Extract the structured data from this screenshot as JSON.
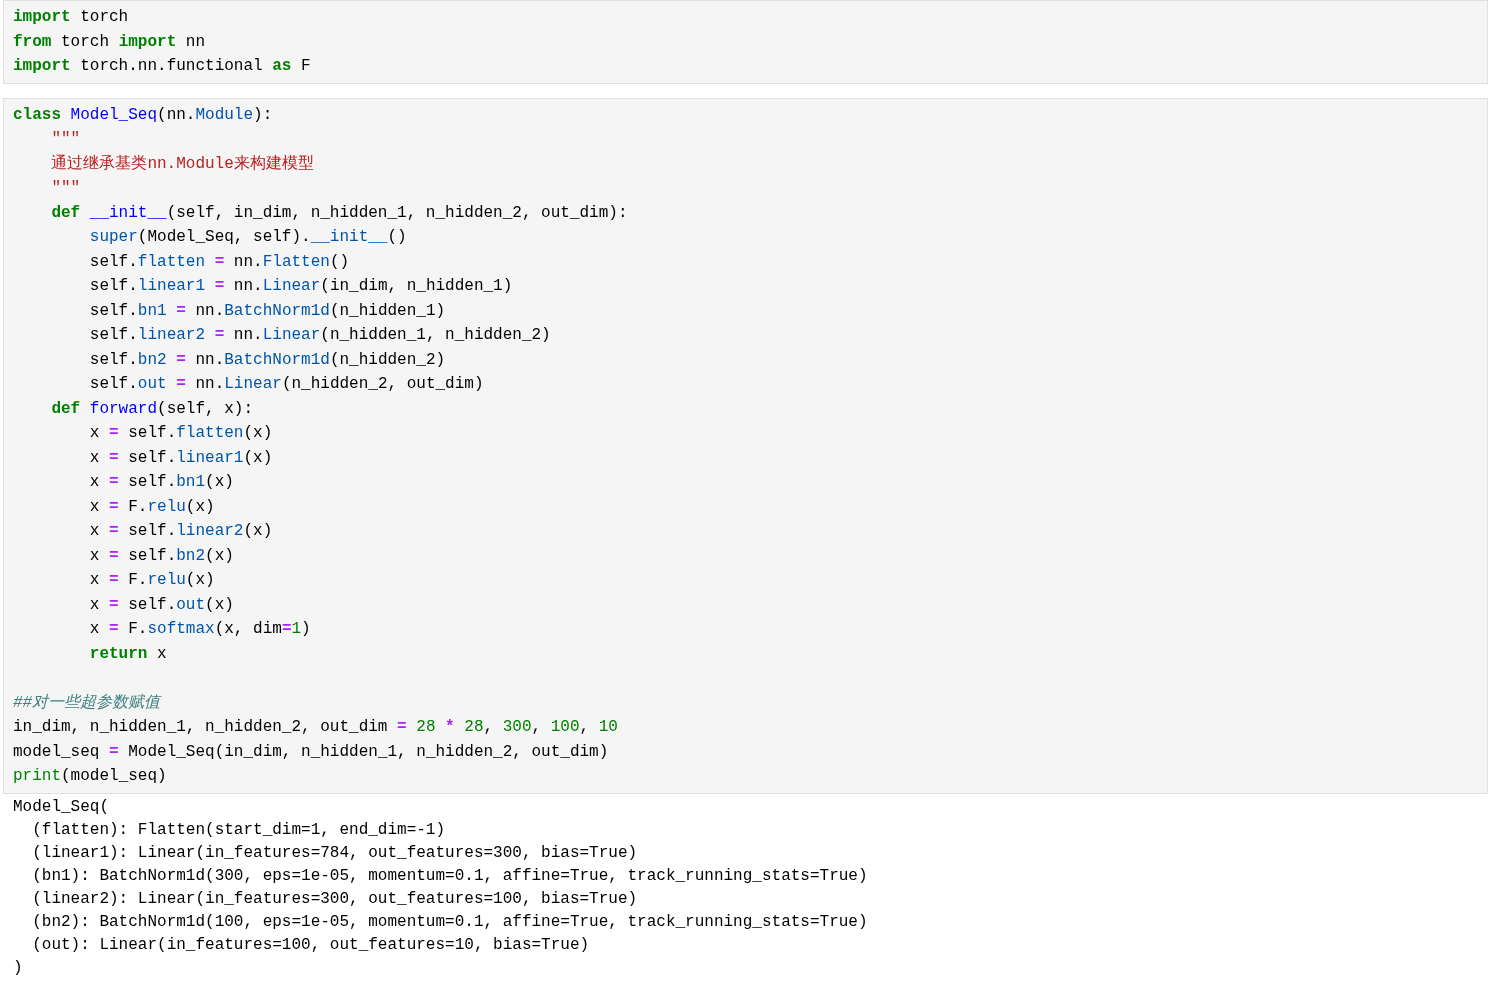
{
  "cells": [
    {
      "kind": "code",
      "blocks": [
        [
          [
            {
              "kind": "kw",
              "text": "import"
            },
            {
              "kind": "plain",
              "text": " torch"
            }
          ],
          [
            {
              "kind": "kw",
              "text": "from"
            },
            {
              "kind": "plain",
              "text": " torch "
            },
            {
              "kind": "kw",
              "text": "import"
            },
            {
              "kind": "plain",
              "text": " nn"
            }
          ],
          [
            {
              "kind": "kw",
              "text": "import"
            },
            {
              "kind": "plain",
              "text": " torch.nn.functional "
            },
            {
              "kind": "kw",
              "text": "as"
            },
            {
              "kind": "plain",
              "text": " F"
            }
          ]
        ]
      ]
    },
    {
      "kind": "code",
      "blocks": [
        [
          [
            {
              "kind": "kw",
              "text": "class "
            },
            {
              "kind": "def",
              "text": "Model_Seq"
            },
            {
              "kind": "plain",
              "text": "(nn."
            },
            {
              "kind": "attr",
              "text": "Module"
            },
            {
              "kind": "plain",
              "text": "):"
            }
          ],
          [
            {
              "kind": "str",
              "text": "    \"\"\""
            }
          ],
          [
            {
              "kind": "str",
              "text": "    通过继承基类nn.Module来构建模型"
            }
          ],
          [
            {
              "kind": "str",
              "text": "    \"\"\""
            }
          ],
          [
            {
              "kind": "kw",
              "text": "    def "
            },
            {
              "kind": "def",
              "text": "__init__"
            },
            {
              "kind": "plain",
              "text": "(self, in_dim, n_hidden_1, n_hidden_2, out_dim):"
            }
          ],
          [
            {
              "kind": "attr",
              "text": "        super"
            },
            {
              "kind": "plain",
              "text": "(Model_Seq, self)."
            },
            {
              "kind": "attr",
              "text": "__init__"
            },
            {
              "kind": "plain",
              "text": "()"
            }
          ],
          [
            {
              "kind": "plain",
              "text": "        self."
            },
            {
              "kind": "attr",
              "text": "flatten"
            },
            {
              "kind": "op",
              "text": " = "
            },
            {
              "kind": "plain",
              "text": "nn."
            },
            {
              "kind": "attr",
              "text": "Flatten"
            },
            {
              "kind": "plain",
              "text": "()"
            }
          ],
          [
            {
              "kind": "plain",
              "text": "        self."
            },
            {
              "kind": "attr",
              "text": "linear1"
            },
            {
              "kind": "op",
              "text": " = "
            },
            {
              "kind": "plain",
              "text": "nn."
            },
            {
              "kind": "attr",
              "text": "Linear"
            },
            {
              "kind": "plain",
              "text": "(in_dim, n_hidden_1)"
            }
          ],
          [
            {
              "kind": "plain",
              "text": "        self."
            },
            {
              "kind": "attr",
              "text": "bn1"
            },
            {
              "kind": "op",
              "text": " = "
            },
            {
              "kind": "plain",
              "text": "nn."
            },
            {
              "kind": "attr",
              "text": "BatchNorm1d"
            },
            {
              "kind": "plain",
              "text": "(n_hidden_1)"
            }
          ],
          [
            {
              "kind": "plain",
              "text": "        self."
            },
            {
              "kind": "attr",
              "text": "linear2"
            },
            {
              "kind": "op",
              "text": " = "
            },
            {
              "kind": "plain",
              "text": "nn."
            },
            {
              "kind": "attr",
              "text": "Linear"
            },
            {
              "kind": "plain",
              "text": "(n_hidden_1, n_hidden_2)"
            }
          ],
          [
            {
              "kind": "plain",
              "text": "        self."
            },
            {
              "kind": "attr",
              "text": "bn2"
            },
            {
              "kind": "op",
              "text": " = "
            },
            {
              "kind": "plain",
              "text": "nn."
            },
            {
              "kind": "attr",
              "text": "BatchNorm1d"
            },
            {
              "kind": "plain",
              "text": "(n_hidden_2)"
            }
          ],
          [
            {
              "kind": "plain",
              "text": "        self."
            },
            {
              "kind": "attr",
              "text": "out"
            },
            {
              "kind": "op",
              "text": " = "
            },
            {
              "kind": "plain",
              "text": "nn."
            },
            {
              "kind": "attr",
              "text": "Linear"
            },
            {
              "kind": "plain",
              "text": "(n_hidden_2, out_dim)"
            }
          ],
          [
            {
              "kind": "kw",
              "text": "    def "
            },
            {
              "kind": "def",
              "text": "forward"
            },
            {
              "kind": "plain",
              "text": "(self, x):"
            }
          ],
          [
            {
              "kind": "plain",
              "text": "        x"
            },
            {
              "kind": "op",
              "text": " = "
            },
            {
              "kind": "plain",
              "text": "self."
            },
            {
              "kind": "attr",
              "text": "flatten"
            },
            {
              "kind": "plain",
              "text": "(x)"
            }
          ],
          [
            {
              "kind": "plain",
              "text": "        x"
            },
            {
              "kind": "op",
              "text": " = "
            },
            {
              "kind": "plain",
              "text": "self."
            },
            {
              "kind": "attr",
              "text": "linear1"
            },
            {
              "kind": "plain",
              "text": "(x)"
            }
          ],
          [
            {
              "kind": "plain",
              "text": "        x"
            },
            {
              "kind": "op",
              "text": " = "
            },
            {
              "kind": "plain",
              "text": "self."
            },
            {
              "kind": "attr",
              "text": "bn1"
            },
            {
              "kind": "plain",
              "text": "(x)"
            }
          ],
          [
            {
              "kind": "plain",
              "text": "        x"
            },
            {
              "kind": "op",
              "text": " = "
            },
            {
              "kind": "plain",
              "text": "F."
            },
            {
              "kind": "attr",
              "text": "relu"
            },
            {
              "kind": "plain",
              "text": "(x)"
            }
          ],
          [
            {
              "kind": "plain",
              "text": "        x"
            },
            {
              "kind": "op",
              "text": " = "
            },
            {
              "kind": "plain",
              "text": "self."
            },
            {
              "kind": "attr",
              "text": "linear2"
            },
            {
              "kind": "plain",
              "text": "(x)"
            }
          ],
          [
            {
              "kind": "plain",
              "text": "        x"
            },
            {
              "kind": "op",
              "text": " = "
            },
            {
              "kind": "plain",
              "text": "self."
            },
            {
              "kind": "attr",
              "text": "bn2"
            },
            {
              "kind": "plain",
              "text": "(x)"
            }
          ],
          [
            {
              "kind": "plain",
              "text": "        x"
            },
            {
              "kind": "op",
              "text": " = "
            },
            {
              "kind": "plain",
              "text": "F."
            },
            {
              "kind": "attr",
              "text": "relu"
            },
            {
              "kind": "plain",
              "text": "(x)"
            }
          ],
          [
            {
              "kind": "plain",
              "text": "        x"
            },
            {
              "kind": "op",
              "text": " = "
            },
            {
              "kind": "plain",
              "text": "self."
            },
            {
              "kind": "attr",
              "text": "out"
            },
            {
              "kind": "plain",
              "text": "(x)"
            }
          ],
          [
            {
              "kind": "plain",
              "text": "        x"
            },
            {
              "kind": "op",
              "text": " = "
            },
            {
              "kind": "plain",
              "text": "F."
            },
            {
              "kind": "attr",
              "text": "softmax"
            },
            {
              "kind": "plain",
              "text": "(x, dim"
            },
            {
              "kind": "op",
              "text": "="
            },
            {
              "kind": "num",
              "text": "1"
            },
            {
              "kind": "plain",
              "text": ")"
            }
          ],
          [
            {
              "kind": "kw",
              "text": "        return"
            },
            {
              "kind": "plain",
              "text": " x"
            }
          ]
        ],
        [
          [
            {
              "kind": "com",
              "text": "##对一些超参数赋值"
            }
          ],
          [
            {
              "kind": "plain",
              "text": "in_dim, n_hidden_1, n_hidden_2, out_dim"
            },
            {
              "kind": "op",
              "text": " = "
            },
            {
              "kind": "num",
              "text": "28"
            },
            {
              "kind": "op",
              "text": " * "
            },
            {
              "kind": "num",
              "text": "28"
            },
            {
              "kind": "plain",
              "text": ", "
            },
            {
              "kind": "num",
              "text": "300"
            },
            {
              "kind": "plain",
              "text": ", "
            },
            {
              "kind": "num",
              "text": "100"
            },
            {
              "kind": "plain",
              "text": ", "
            },
            {
              "kind": "num",
              "text": "10"
            }
          ],
          [
            {
              "kind": "plain",
              "text": "model_seq"
            },
            {
              "kind": "op",
              "text": " = "
            },
            {
              "kind": "plain",
              "text": "Model_Seq(in_dim, n_hidden_1, n_hidden_2, out_dim)"
            }
          ],
          [
            {
              "kind": "builtin",
              "text": "print"
            },
            {
              "kind": "plain",
              "text": "(model_seq)"
            }
          ]
        ]
      ]
    },
    {
      "kind": "output",
      "lines": [
        "Model_Seq(",
        "  (flatten): Flatten(start_dim=1, end_dim=-1)",
        "  (linear1): Linear(in_features=784, out_features=300, bias=True)",
        "  (bn1): BatchNorm1d(300, eps=1e-05, momentum=0.1, affine=True, track_running_stats=True)",
        "  (linear2): Linear(in_features=300, out_features=100, bias=True)",
        "  (bn2): BatchNorm1d(100, eps=1e-05, momentum=0.1, affine=True, track_running_stats=True)",
        "  (out): Linear(in_features=100, out_features=10, bias=True)",
        ")"
      ]
    }
  ]
}
